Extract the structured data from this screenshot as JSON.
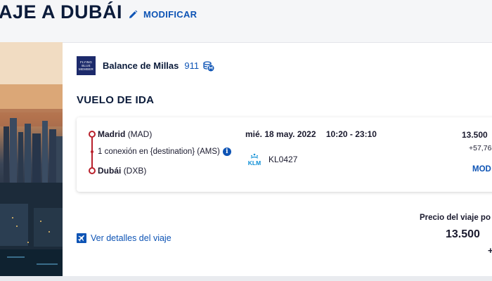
{
  "header": {
    "title": "AJE A DUBÁI",
    "modify_label": "MODIFICAR",
    "modify_icon": "pencil-icon"
  },
  "miles": {
    "badge_lines": [
      "FLYING",
      "BLUE",
      "MEMBER"
    ],
    "label": "Balance de Millas",
    "value": "911",
    "icon": "miles-coin-icon"
  },
  "outbound": {
    "section_title": "VUELO DE IDA",
    "origin_city": "Madrid",
    "origin_code": "(MAD)",
    "connection_text": "1 conexión en {destination} (AMS)",
    "destination_city": "Dubái",
    "destination_code": "(DXB)",
    "date": "mié. 18 may. 2022",
    "times": "10:20 - 23:10",
    "airline": "KLM",
    "flight_number": "KL0427",
    "price": "13.500",
    "price_extra": "+57,76",
    "modify_label": "MOD"
  },
  "footer": {
    "details_label": "Ver detalles del viaje",
    "trip_price_label": "Precio del viaje po",
    "trip_price_value": "13.500",
    "trip_price_plus": "+"
  },
  "colors": {
    "brand_blue": "#0e54b5",
    "route_red": "#b8202b",
    "text_dark": "#0b1b3a",
    "flying_blue": "#1c2a6b"
  }
}
